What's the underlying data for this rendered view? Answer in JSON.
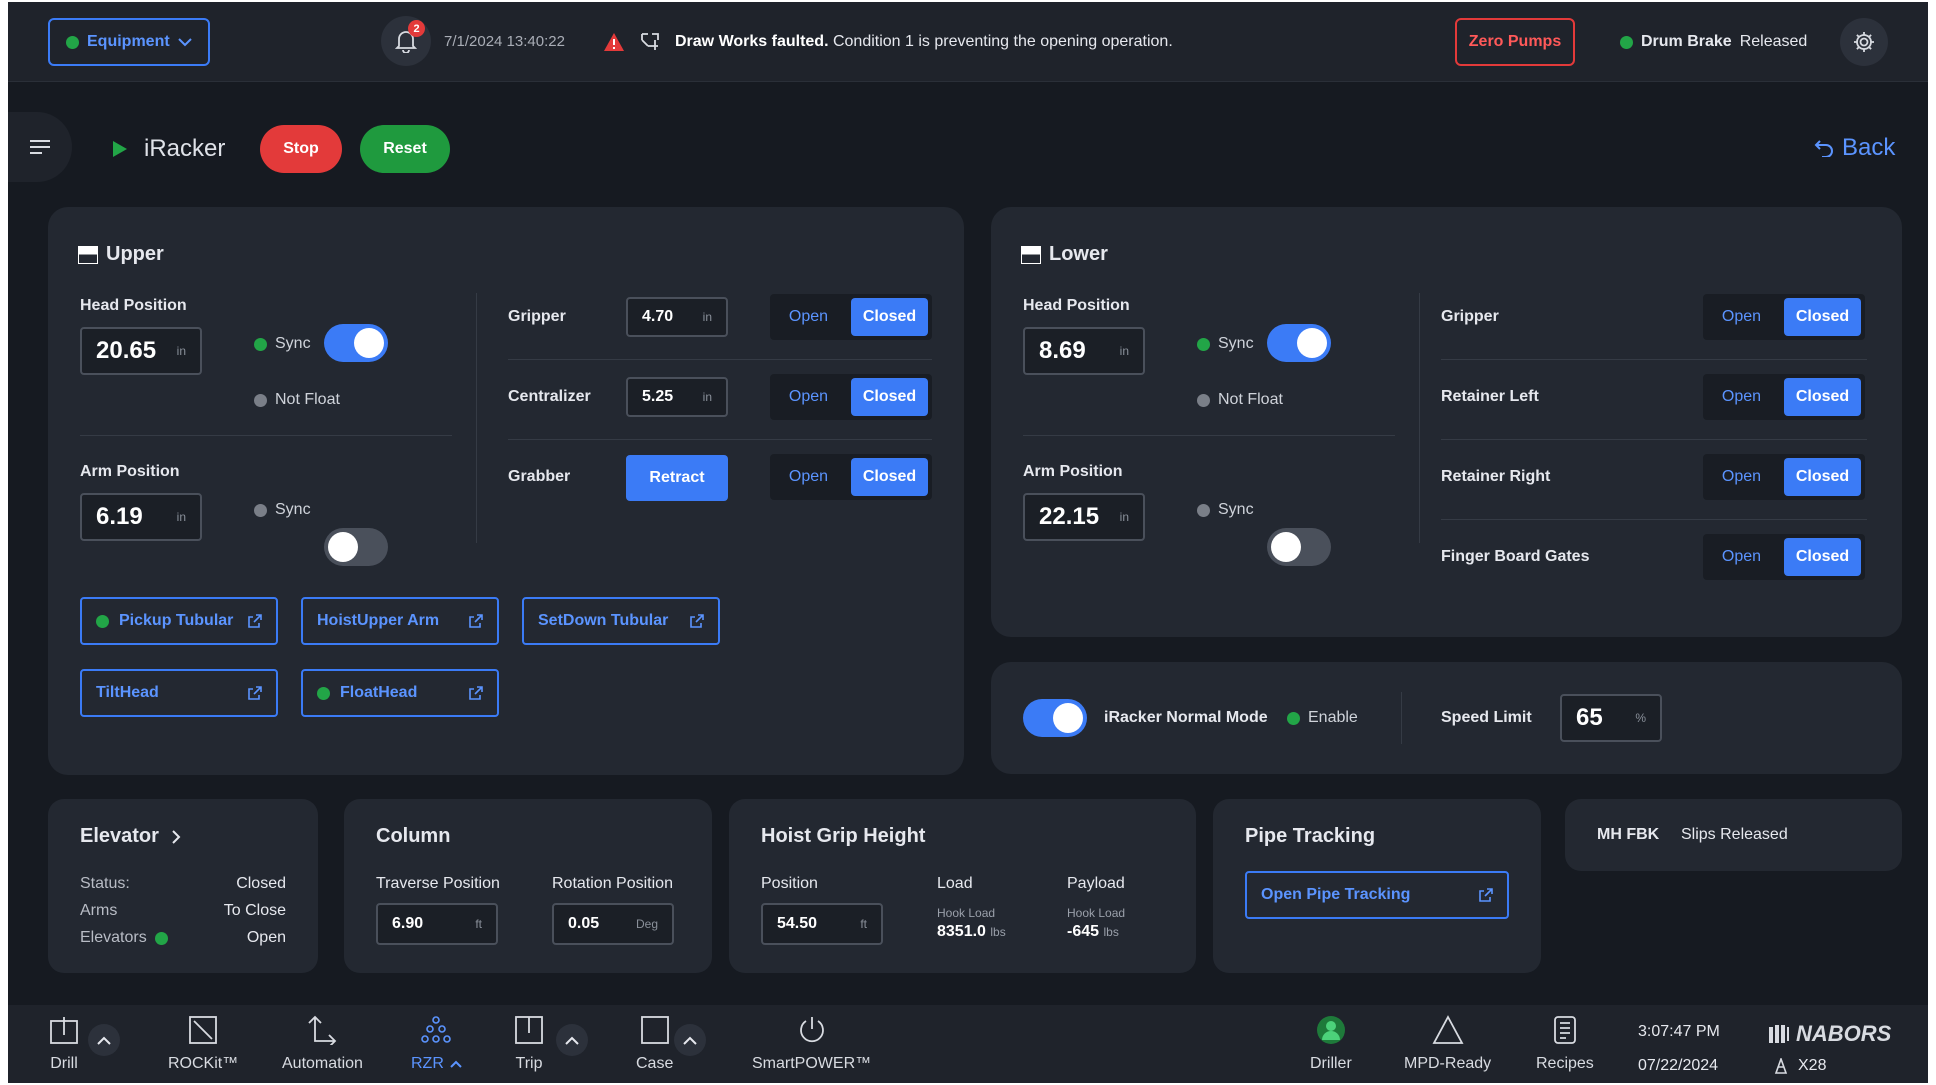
{
  "topbar": {
    "equipment_label": "Equipment",
    "notification_count": "2",
    "timestamp": "7/1/2024  13:40:22",
    "alarm_bold": "Draw Works faulted.",
    "alarm_text": "Condition 1 is preventing the opening operation.",
    "zero_pumps_label": "Zero Pumps",
    "drum_brake_label": "Drum Brake",
    "drum_brake_status": "Released"
  },
  "header": {
    "title": "iRacker",
    "stop_label": "Stop",
    "reset_label": "Reset",
    "back_label": "Back"
  },
  "upper": {
    "title": "Upper",
    "head_position_label": "Head Position",
    "head_position": "20.65",
    "arm_position_label": "Arm Position",
    "arm_position": "6.19",
    "unit": "in",
    "sync_label": "Sync",
    "not_float_label": "Not Float",
    "rows": [
      {
        "label": "Gripper",
        "value": "4.70"
      },
      {
        "label": "Centralizer",
        "value": "5.25"
      },
      {
        "label": "Grabber",
        "action": "Retract"
      }
    ],
    "open_label": "Open",
    "closed_label": "Closed",
    "actions": [
      "Pickup Tubular",
      "HoistUpper Arm",
      "SetDown Tubular",
      "TiltHead",
      "FloatHead"
    ]
  },
  "lower": {
    "title": "Lower",
    "head_position_label": "Head Position",
    "head_position": "8.69",
    "arm_position_label": "Arm Position",
    "arm_position": "22.15",
    "unit": "in",
    "sync_label": "Sync",
    "not_float_label": "Not Float",
    "rows": [
      "Gripper",
      "Retainer Left",
      "Retainer Right",
      "Finger Board Gates"
    ],
    "open_label": "Open",
    "closed_label": "Closed"
  },
  "mode": {
    "normal_mode_label": "iRacker Normal Mode",
    "enable_label": "Enable",
    "speed_limit_label": "Speed Limit",
    "speed_limit": "65",
    "speed_unit": "%"
  },
  "elevator": {
    "title": "Elevator",
    "rows": [
      {
        "k": "Status:",
        "v": "Closed"
      },
      {
        "k": "Arms",
        "v": "To Close"
      },
      {
        "k": "Elevators",
        "v": "Open"
      }
    ]
  },
  "column": {
    "title": "Column",
    "traverse_label": "Traverse Position",
    "traverse": "6.90",
    "traverse_unit": "ft",
    "rotation_label": "Rotation Position",
    "rotation": "0.05",
    "rotation_unit": "Deg"
  },
  "hoist": {
    "title": "Hoist Grip Height",
    "position_label": "Position",
    "position": "54.50",
    "position_unit": "ft",
    "load_label": "Load",
    "hook_load_label": "Hook Load",
    "load": "8351.0",
    "load_unit": "lbs",
    "payload_label": "Payload",
    "payload": "-645",
    "payload_unit": "lbs"
  },
  "pipe": {
    "title": "Pipe Tracking",
    "open_label": "Open Pipe Tracking"
  },
  "mhfbk": {
    "label": "MH FBK",
    "status": "Slips Released"
  },
  "nav": {
    "items": [
      "Drill",
      "ROCKit™",
      "Automation",
      "RZR",
      "Trip",
      "Case",
      "SmartPOWER™",
      "Driller",
      "MPD-Ready",
      "Recipes"
    ],
    "time": "3:07:47 PM",
    "date": "07/22/2024",
    "brand": "NABORS",
    "rig": "X28"
  },
  "colors": {
    "accent": "#3b7bf6",
    "danger": "#e33a3a",
    "success": "#22a547",
    "bg": "#161a21",
    "card": "#232831"
  }
}
